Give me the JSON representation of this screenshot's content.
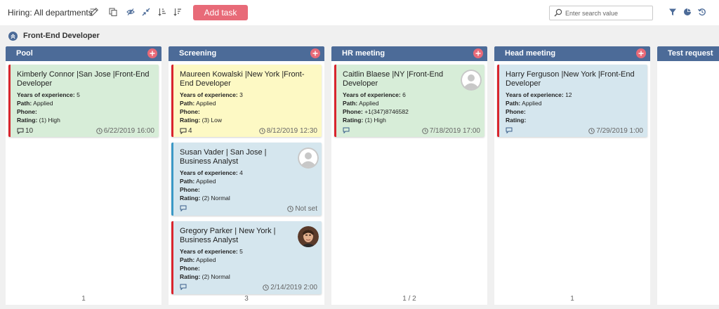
{
  "header": {
    "title": "Hiring: All departments",
    "add_button": "Add task",
    "search_placeholder": "Enter search value"
  },
  "group": {
    "label": "Front-End Developer"
  },
  "colors": {
    "column_header": "#4c6b98",
    "accent": "#e86a78",
    "card_green": "#d7edd8",
    "card_yellow": "#fdf9c4",
    "card_blue": "#d5e6ee",
    "priority_red": "#d9252e",
    "priority_blue": "#3b99c6"
  },
  "columns": [
    {
      "title": "Pool",
      "footer": "1",
      "cards": [
        {
          "title": "Kimberly Connor |San Jose |Front-End Developer",
          "years_label": "Years of experience:",
          "years": "5",
          "path_label": "Path:",
          "path": "Applied",
          "phone_label": "Phone:",
          "phone": "",
          "rating_label": "Rating:",
          "rating": "(1) High",
          "comments": "10",
          "date": "6/22/2019 16:00"
        }
      ]
    },
    {
      "title": "Screening",
      "footer": "3",
      "cards": [
        {
          "title": "Maureen Kowalski |New York |Front-End Developer",
          "years_label": "Years of experience:",
          "years": "3",
          "path_label": "Path:",
          "path": "Applied",
          "phone_label": "Phone:",
          "phone": "",
          "rating_label": "Rating:",
          "rating": "(3) Low",
          "comments": "4",
          "date": "8/12/2019 12:30"
        },
        {
          "title": "Susan Vader | San Jose | Business Analyst",
          "years_label": "Years of experience:",
          "years": "4",
          "path_label": "Path:",
          "path": "Applied",
          "phone_label": "Phone:",
          "phone": "",
          "rating_label": "Rating:",
          "rating": "(2) Normal",
          "comments": "",
          "date": "Not set"
        },
        {
          "title": "Gregory Parker | New York | Business Analyst",
          "years_label": "Years of experience:",
          "years": "5",
          "path_label": "Path:",
          "path": "Applied",
          "phone_label": "Phone:",
          "phone": "",
          "rating_label": "Rating:",
          "rating": "(2) Normal",
          "comments": "",
          "date": "2/14/2019 2:00"
        }
      ]
    },
    {
      "title": "HR meeting",
      "footer": "1 / 2",
      "cards": [
        {
          "title": "Caitlin Blaese |NY |Front-End Developer",
          "years_label": "Years of experience:",
          "years": "6",
          "path_label": "Path:",
          "path": "Applied",
          "phone_label": "Phone:",
          "phone": "+1(347)8746582",
          "rating_label": "Rating:",
          "rating": "(1) High",
          "comments": "",
          "date": "7/18/2019 17:00"
        }
      ]
    },
    {
      "title": "Head meeting",
      "footer": "1",
      "cards": [
        {
          "title": "Harry Ferguson |New York |Front-End Developer",
          "years_label": "Years of experience:",
          "years": "12",
          "path_label": "Path:",
          "path": "Applied",
          "phone_label": "Phone:",
          "phone": "",
          "rating_label": "Rating:",
          "rating": "",
          "comments": "",
          "date": "7/29/2019 1:00"
        }
      ]
    },
    {
      "title": "Test request",
      "footer": "",
      "cards": []
    }
  ]
}
